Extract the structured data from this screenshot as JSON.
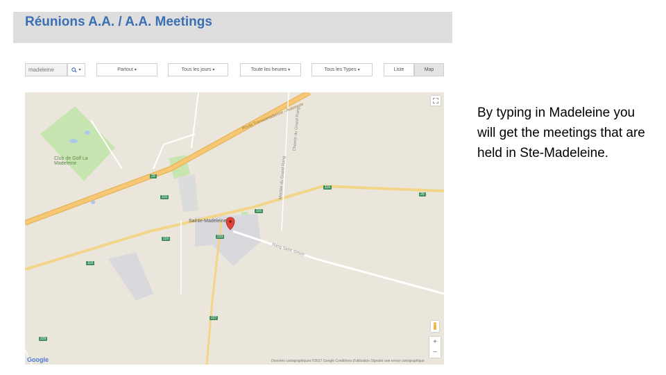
{
  "header": {
    "title": "Réunions A.A. / A.A. Meetings"
  },
  "toolbar": {
    "search_value": "madeleine",
    "filters": [
      {
        "label": "Partout"
      },
      {
        "label": "Tous les jours"
      },
      {
        "label": "Toute les heures"
      },
      {
        "label": "Tous les Types"
      }
    ],
    "view_list": "Liste",
    "view_map": "Map",
    "active_view": "Map"
  },
  "map": {
    "labels": {
      "road_transcanadienne": "Route Transcanadienne - Autoroute",
      "club_golf": "Club de Golf La Madeleine",
      "sainte_madeleine": "Sainte-Madeleine",
      "rang_saint_simon": "Rang Saint-Simon",
      "montee_saint_simon": "Montée du Grand Rang",
      "chemin_grand_rang": "Chemin du Grand Rang"
    },
    "shields": [
      "20",
      "116",
      "116",
      "116",
      "116",
      "223",
      "227",
      "229",
      "20",
      "116"
    ],
    "google": "Google",
    "attribution": "Données cartographiques ©2017 Google   Conditions d'utilisation   Signaler une erreur cartographique"
  },
  "caption": "By typing in Madeleine you will get the meetings that are held in Ste-Madeleine.",
  "colors": {
    "title": "#3a6fb3",
    "header_bg": "#dedede",
    "map_bg": "#ebe6dc",
    "highway": "#f6c876",
    "park": "#c7e5b0",
    "marker": "#e0453a"
  }
}
